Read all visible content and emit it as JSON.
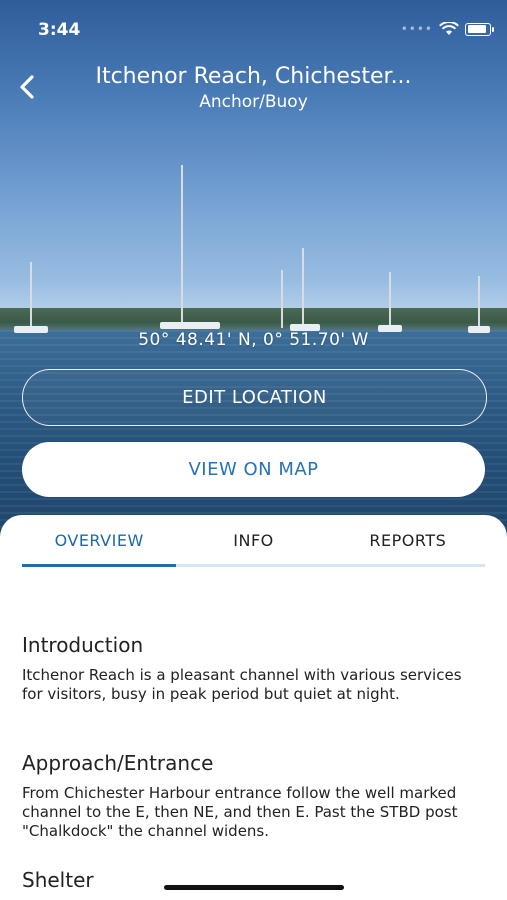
{
  "status_bar": {
    "time": "3:44",
    "signal_icon": "signal-dots-icon",
    "wifi_icon": "wifi-icon",
    "battery_icon": "battery-icon"
  },
  "header": {
    "title": "Itchenor Reach, Chichester...",
    "subtitle": "Anchor/Buoy",
    "back_icon": "chevron-left-icon"
  },
  "location": {
    "coordinates": "50° 48.41' N, 0° 51.70' W"
  },
  "actions": {
    "edit_label": "EDIT LOCATION",
    "map_label": "VIEW ON MAP"
  },
  "tabs": [
    {
      "label": "OVERVIEW",
      "active": true
    },
    {
      "label": "INFO",
      "active": false
    },
    {
      "label": "REPORTS",
      "active": false
    }
  ],
  "sections": [
    {
      "heading": "Introduction",
      "body": "Itchenor Reach is a pleasant channel with various services for visitors, busy in peak period but quiet at night."
    },
    {
      "heading": "Approach/Entrance",
      "body": "From Chichester Harbour entrance follow the well marked channel to the E, then NE, and then E. Past the STBD post \"Chalkdock\" the channel widens."
    },
    {
      "heading": "Shelter",
      "body": ""
    }
  ],
  "colors": {
    "accent": "#2673b8",
    "tab_indicator": "#1e6ea9",
    "tab_track": "#d6e6f3"
  }
}
